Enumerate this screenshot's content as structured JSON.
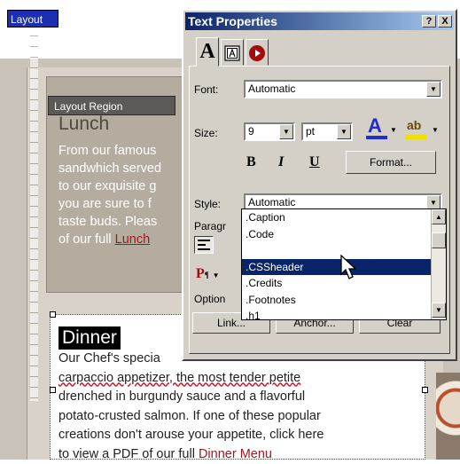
{
  "layout_tab": "Layout",
  "lunch": {
    "region_label": "Layout Region",
    "title": "Lunch",
    "text": "From our famous\nsandwhich served\nto our exquisite g\nyou are sure to f\ntaste buds.  Pleas\nof our full ",
    "link": "Lunch"
  },
  "dinner": {
    "title": "Dinner",
    "lines": [
      "Our Chef's specia",
      "carpaccio appetizer, the most tender petite",
      "drenched in burgundy sauce and a flavorful",
      "potato-crusted salmon.  If one of these popular",
      "creations don't arouse your appetite, click here",
      "to view a PDF of our full "
    ],
    "link": "Dinner Menu"
  },
  "dialog": {
    "title": "Text Properties",
    "help_button": "?",
    "close_button": "X",
    "tab_text_glyph": "A",
    "font": {
      "label": "Font:",
      "value": "Automatic"
    },
    "size": {
      "label": "Size:",
      "value": "9",
      "unit": "pt"
    },
    "bold": "B",
    "italic": "I",
    "underline": "U",
    "format_button": "Format...",
    "style": {
      "label": "Style:",
      "value": "Automatic"
    },
    "paragraph_label": "Paragr",
    "options_label": "Option",
    "bottom_buttons": {
      "link": "Link...",
      "anchor": "Anchor...",
      "clear": "Clear"
    },
    "highlight_label": "ab",
    "font_color_label": "A",
    "para_glyph": "P",
    "style_options": [
      ".Caption",
      ".Code",
      "",
      ".CSSheader",
      ".Credits",
      ".Footnotes",
      ".h1"
    ],
    "selected_option": ".CSSheader"
  },
  "colors": {
    "title_gradient_start": "#0a246a",
    "selection": "#0a246a",
    "link": "#a6161c",
    "font_color_bar": "#1e2dcc",
    "highlight_bar": "#f0e000"
  }
}
